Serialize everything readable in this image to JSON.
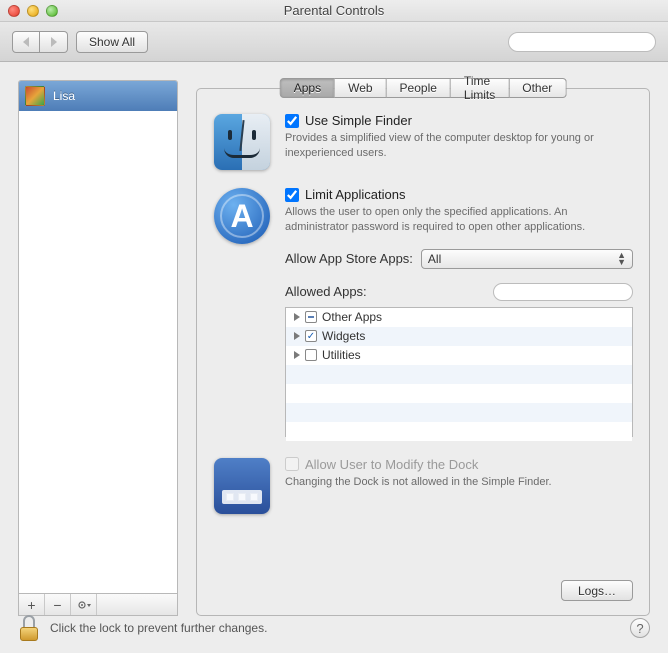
{
  "window": {
    "title": "Parental Controls"
  },
  "toolbar": {
    "show_all": "Show All",
    "search_placeholder": ""
  },
  "sidebar": {
    "users": [
      {
        "name": "Lisa"
      }
    ],
    "add_label": "+",
    "remove_label": "−",
    "action_label": "✻"
  },
  "tabs": [
    {
      "label": "Apps",
      "active": true
    },
    {
      "label": "Web",
      "active": false
    },
    {
      "label": "People",
      "active": false
    },
    {
      "label": "Time Limits",
      "active": false
    },
    {
      "label": "Other",
      "active": false
    }
  ],
  "simple_finder": {
    "checked": true,
    "label": "Use Simple Finder",
    "desc": "Provides a simplified view of the computer desktop for young or inexperienced users."
  },
  "limit_apps": {
    "checked": true,
    "label": "Limit Applications",
    "desc": "Allows the user to open only the specified applications. An administrator password is required to open other applications.",
    "allow_store_label": "Allow App Store Apps:",
    "allow_store_value": "All",
    "allowed_label": "Allowed Apps:",
    "search_placeholder": "",
    "tree": [
      {
        "label": "Other Apps",
        "state": "mixed"
      },
      {
        "label": "Widgets",
        "state": "checked"
      },
      {
        "label": "Utilities",
        "state": "unchecked"
      }
    ]
  },
  "dock": {
    "checked": false,
    "disabled": true,
    "label": "Allow User to Modify the Dock",
    "desc": "Changing the Dock is not allowed in the Simple Finder."
  },
  "logs_button": "Logs…",
  "footer": {
    "lock_text": "Click the lock to prevent further changes.",
    "help": "?"
  }
}
